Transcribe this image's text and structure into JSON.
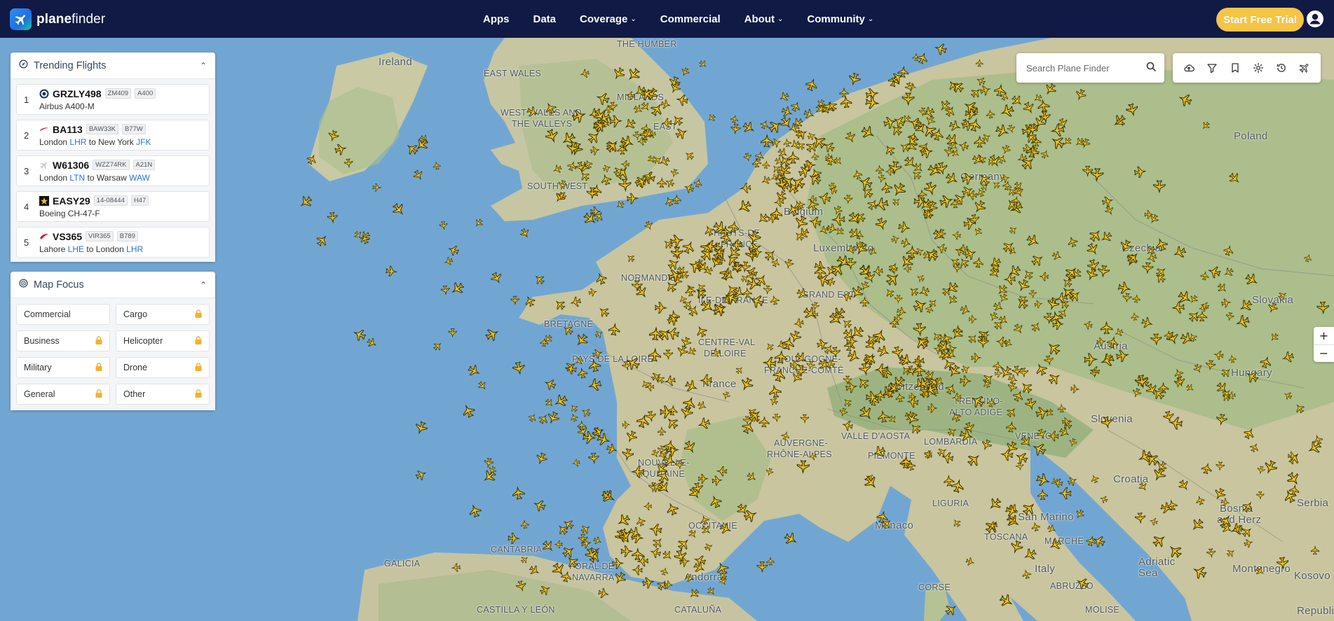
{
  "brand": {
    "name_bold": "plane",
    "name_rest": "finder"
  },
  "nav": [
    {
      "label": "Apps",
      "dropdown": false
    },
    {
      "label": "Data",
      "dropdown": false
    },
    {
      "label": "Coverage",
      "dropdown": true
    },
    {
      "label": "Commercial",
      "dropdown": false
    },
    {
      "label": "About",
      "dropdown": true
    },
    {
      "label": "Community",
      "dropdown": true
    }
  ],
  "header": {
    "trial_label": "Start Free Trial"
  },
  "trending": {
    "title": "Trending Flights",
    "items": [
      {
        "rank": "1",
        "callsign": "GRZLY498",
        "tags": [
          "ZM409",
          "A400"
        ],
        "line": "Airbus A400-M",
        "from_city": "",
        "from_code": "",
        "to_city": "",
        "to_code": "",
        "icon": "raf-roundel-icon"
      },
      {
        "rank": "2",
        "callsign": "BA113",
        "tags": [
          "BAW33K",
          "B77W"
        ],
        "line": "",
        "from_city": "London",
        "from_code": "LHR",
        "to_city": "New York",
        "to_code": "JFK",
        "icon": "british-airways-icon"
      },
      {
        "rank": "3",
        "callsign": "W61306",
        "tags": [
          "WZZ74RK",
          "A21N"
        ],
        "line": "",
        "from_city": "London",
        "from_code": "LTN",
        "to_city": "Warsaw",
        "to_code": "WAW",
        "icon": "plane-gray-icon"
      },
      {
        "rank": "4",
        "callsign": "EASY29",
        "tags": [
          "14-08444",
          "H47"
        ],
        "line": "Boeing CH-47-F",
        "from_city": "",
        "from_code": "",
        "to_city": "",
        "to_code": "",
        "icon": "army-star-icon"
      },
      {
        "rank": "5",
        "callsign": "VS365",
        "tags": [
          "VIR365",
          "B789"
        ],
        "line": "",
        "from_city": "Lahore",
        "from_code": "LHE",
        "to_city": "London",
        "to_code": "LHR",
        "icon": "virgin-icon"
      }
    ],
    "to_word": "to"
  },
  "focus": {
    "title": "Map Focus",
    "items": [
      {
        "label": "Commercial",
        "locked": false
      },
      {
        "label": "Cargo",
        "locked": true
      },
      {
        "label": "Business",
        "locked": true
      },
      {
        "label": "Helicopter",
        "locked": true
      },
      {
        "label": "Military",
        "locked": true
      },
      {
        "label": "Drone",
        "locked": true
      },
      {
        "label": "General",
        "locked": true
      },
      {
        "label": "Other",
        "locked": true
      }
    ]
  },
  "search": {
    "placeholder": "Search Plane Finder"
  },
  "tools": [
    "cloud-upload-icon",
    "filter-icon",
    "bookmark-icon",
    "gear-icon",
    "history-icon",
    "ar-plane-icon"
  ],
  "zoom": {
    "in": "+",
    "out": "−"
  },
  "map_labels": {
    "ireland": "Ireland",
    "east_wales": "EAST WALES",
    "midlands": "MIDLANDS",
    "the_humber": "THE HUMBER",
    "west_wales": "WEST WALES AND",
    "the_valleys": "THE VALLEYS",
    "east": "EAST",
    "south_west": "SOUTH WEST",
    "normandie": "NORMANDIE",
    "bretagne": "BRETAGNE",
    "hauts_de": "HAUTS-DE",
    "france_region": "FRANCE",
    "ile_de_france": "ÎLE-DE-FRANCE",
    "grand_est": "GRAND EST",
    "centre_val": "CENTRE-VAL",
    "de_loire": "DE LOIRE",
    "pays_de_la_loire": "PAYS DE LA LOIRE",
    "bourgogne": "BOURGOGNE-",
    "franche_comte": "FRANCHE-COMTÉ",
    "france": "France",
    "nouvelle": "NOUVELLE-",
    "aquitaine": "AQUITAINE",
    "auvergne": "AUVERGNE-",
    "rhone_alpes": "RHÔNE-ALPES",
    "occitanie": "OCCITANIE",
    "switzerland": "Switzerland",
    "germany": "Germany",
    "belgium": "Belgium",
    "luxembourg": "Luxembourg",
    "poland": "Poland",
    "czechia": "Czechia",
    "slovakia": "Slovakia",
    "austria": "Austria",
    "hungary": "Hungary",
    "slovenia": "Slovenia",
    "croatia": "Croatia",
    "trentino": "TRENTINO-",
    "alto_adige": "ALTO ADIGE",
    "veneto": "VENETO",
    "valle_daosta": "VALLE D'AOSTA",
    "lombardia": "LOMBARDIA",
    "piemonte": "PIEMONTE",
    "liguria": "LIGURIA",
    "toscana": "TOSCANA",
    "marche": "MARCHE",
    "italy": "Italy",
    "abruzzo": "ABRUZZO",
    "molise": "MOLISE",
    "corse": "CORSE",
    "galicia": "GALICIA",
    "cantabria": "CANTABRIA",
    "foral_de": "FORAL DE",
    "navarra": "NAVARRA",
    "andorra": "Andorra",
    "castilla": "CASTILLA Y LEÓN",
    "cataluna": "CATALUÑA",
    "monaco": "Monaco",
    "san_marino": "San Marino",
    "adriatic": "Adriatic",
    "sea": "Sea",
    "bosnia": "Bosnia",
    "and_herz": "and Herz",
    "serbia": "Serbia",
    "montenegro": "Montenegro",
    "kosovo": "Kosovo",
    "republic": "Republic"
  }
}
